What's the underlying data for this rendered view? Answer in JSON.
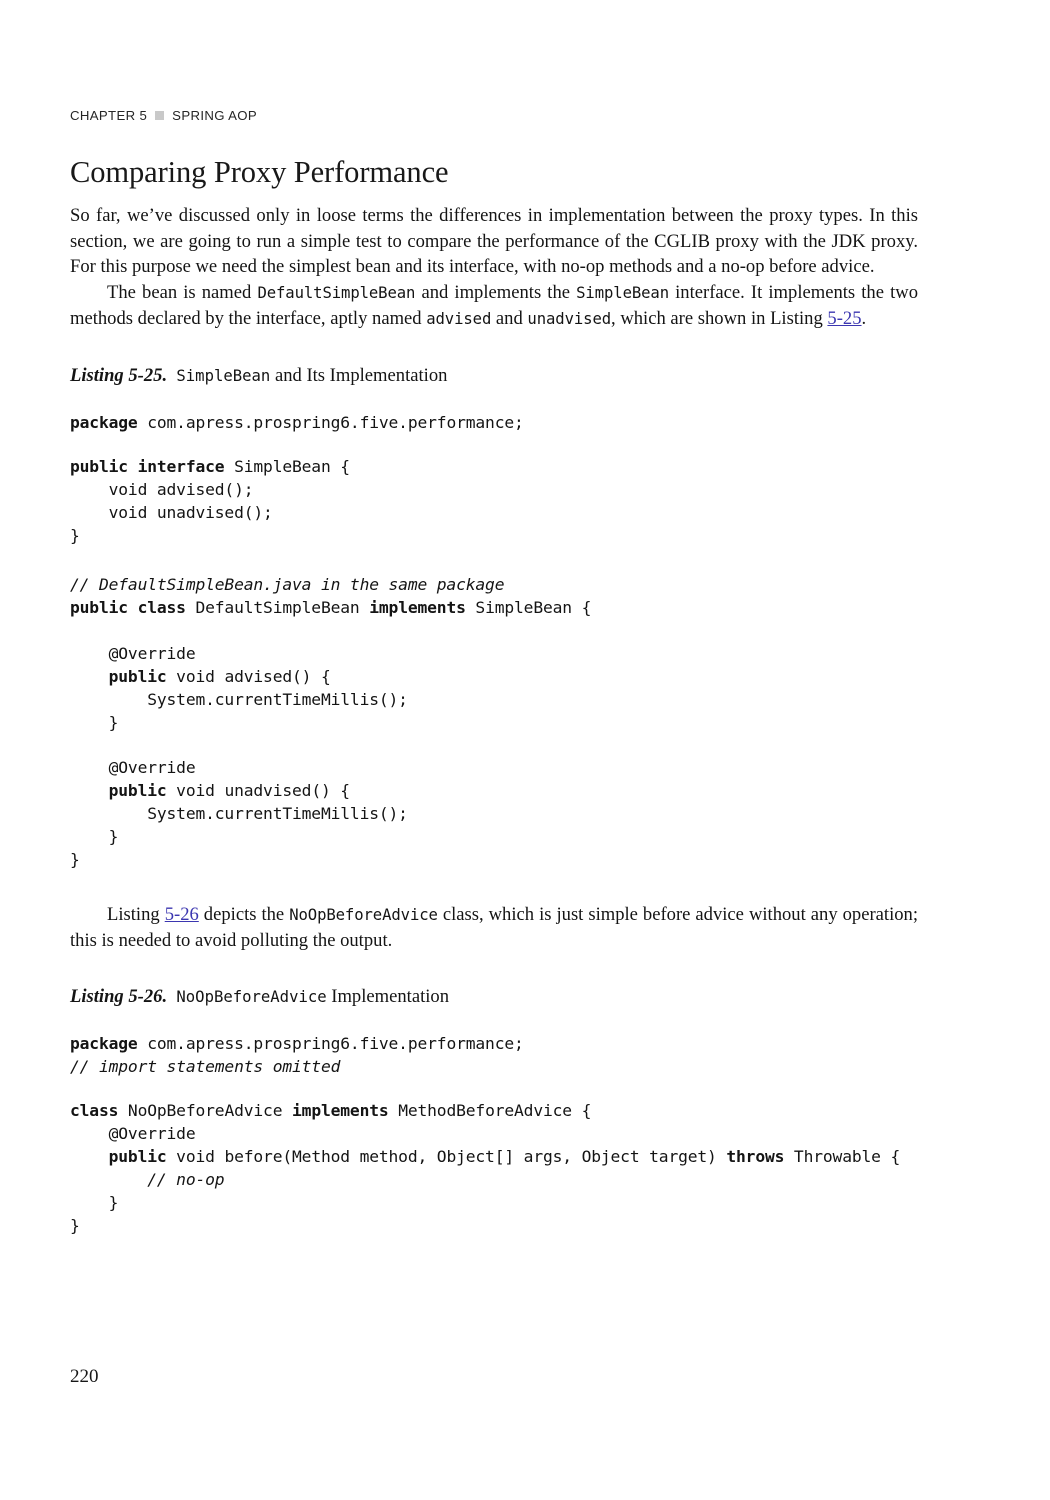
{
  "running_head": {
    "chapter": "CHAPTER 5",
    "separator_icon": "square-separator-icon",
    "title": "SPRING AOP"
  },
  "heading": {
    "text": "Comparing Proxy Performance"
  },
  "colors": {
    "text": "#141414",
    "link": "#3b36b0",
    "separator_square": "#c9c9c9"
  },
  "paragraphs": {
    "intro_part1": "So far, we’ve discussed only in loose terms the differences in implementation between the proxy types. In this section, we are going to run a simple test to compare the performance of the CGLIB proxy with the JDK proxy. For this purpose we need the simplest bean and its interface, with no-op methods and a no-op before advice.",
    "bean_p_a": "The bean is named ",
    "bean_code_1": "DefaultSimpleBean",
    "bean_p_b": " and implements the ",
    "bean_code_2": "SimpleBean",
    "bean_p_c": " interface. It implements the two methods declared by the interface, aptly named ",
    "bean_code_3": "advised",
    "bean_p_d": " and ",
    "bean_code_4": "unadvised",
    "bean_p_e": ", which are shown in Listing ",
    "bean_link": "5-25",
    "bean_p_f": ".",
    "advice_p_a": "Listing ",
    "advice_link": "5-26",
    "advice_p_b": " depicts the ",
    "advice_code_1": "NoOpBeforeAdvice",
    "advice_p_c": " class, which is just simple before advice without any operation; this is needed to avoid polluting the output."
  },
  "listing_25": {
    "label": "Listing 5-25.",
    "title_a": "SimpleBean",
    "title_b": " and Its Implementation",
    "code_block_1_pre": "package",
    "code_block_1_rest": " com.apress.prospring6.five.performance;",
    "code_block_2": "public interface SimpleBean {\n    void advised();\n    void unadvised();\n}",
    "code_block_3_comment": "// DefaultSimpleBean.java in the same package",
    "code_block_3": "public class DefaultSimpleBean implements SimpleBean {\n\n    @Override\n    public void advised() {\n        System.currentTimeMillis();\n    }\n\n    @Override\n    public void unadvised() {\n        System.currentTimeMillis();\n    }\n}"
  },
  "listing_26": {
    "label": "Listing 5-26.",
    "title_a": "NoOpBeforeAdvice",
    "title_b": " Implementation",
    "code_package_kw": "package",
    "code_package_rest": " com.apress.prospring6.five.performance;",
    "code_import_comment": "// import statements omitted",
    "code_class": "class NoOpBeforeAdvice implements MethodBeforeAdvice {\n    @Override\n    public void before(Method method, Object[] args, Object target) throws Throwable {\n        // no-op\n    }\n}"
  },
  "folio": {
    "page_number": "220"
  }
}
